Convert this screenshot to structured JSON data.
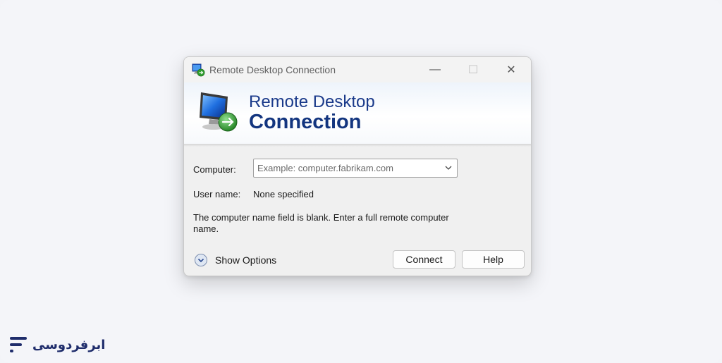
{
  "window": {
    "title": "Remote Desktop Connection",
    "app_icon": "remote-desktop-icon",
    "controls": {
      "minimize": "—",
      "maximize": "☐",
      "close": "✕"
    }
  },
  "banner": {
    "line1": "Remote Desktop",
    "line2": "Connection",
    "icon": "monitor-connection-icon"
  },
  "form": {
    "computer_label": "Computer:",
    "computer_placeholder": "Example: computer.fabrikam.com",
    "user_label": "User name:",
    "user_value": "None specified",
    "message": "The computer name field is blank. Enter a full remote computer name."
  },
  "footer": {
    "show_options_label": "Show Options",
    "connect_label": "Connect",
    "help_label": "Help"
  },
  "brand": {
    "text": "ابرفردوسی"
  },
  "colors": {
    "accent": "#13357f",
    "background": "#f4f5f9",
    "dialog": "#f0f0f0"
  }
}
